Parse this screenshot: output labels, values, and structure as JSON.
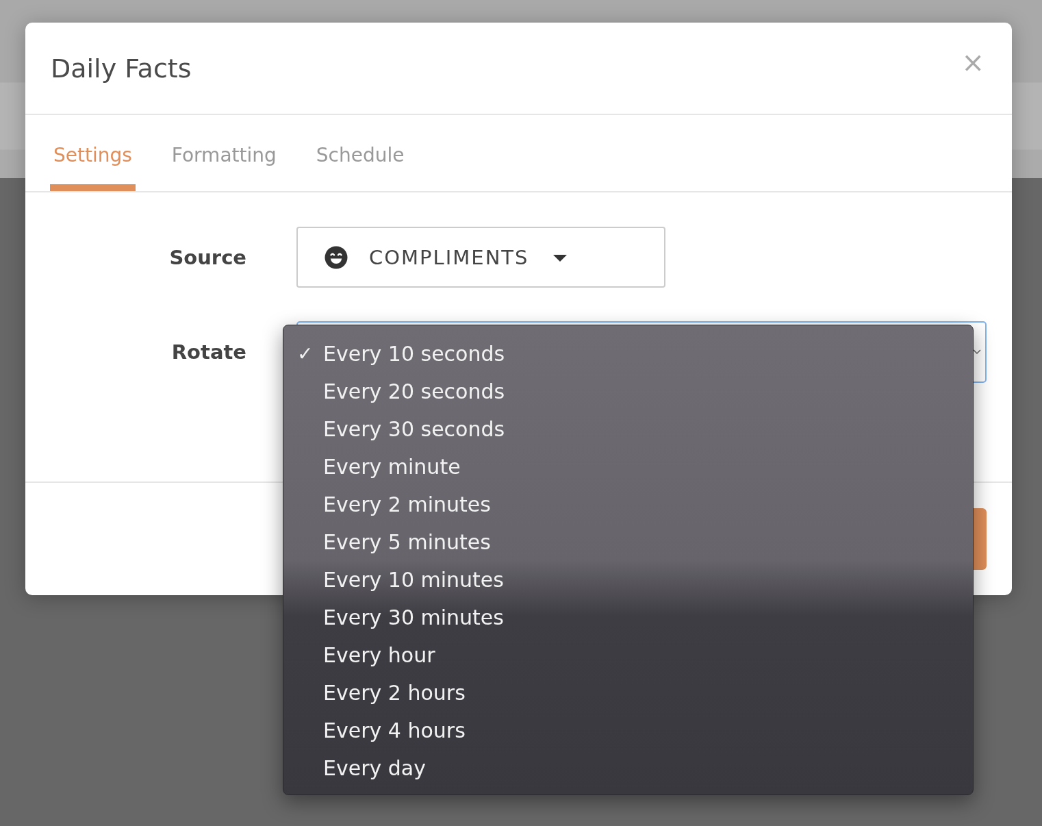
{
  "dialog": {
    "title": "Daily Facts",
    "close": "×"
  },
  "tabs": [
    {
      "label": "Settings",
      "selected": true
    },
    {
      "label": "Formatting",
      "selected": false
    },
    {
      "label": "Schedule",
      "selected": false
    }
  ],
  "fields": [
    {
      "label": "Source",
      "kind": "select",
      "value": "COMPLIMENTS"
    },
    {
      "label": "Rotate",
      "kind": "open_select"
    }
  ],
  "menu": {
    "check": "✓",
    "items": [
      {
        "label": "Every 10 seconds",
        "selected": true
      },
      {
        "label": "Every 20 seconds",
        "selected": false
      },
      {
        "label": "Every 30 seconds",
        "selected": false
      },
      {
        "label": "Every minute",
        "selected": false
      },
      {
        "label": "Every 2 minutes",
        "selected": false
      },
      {
        "label": "Every 5 minutes",
        "selected": false
      },
      {
        "label": "Every 10 minutes",
        "selected": false
      },
      {
        "label": "Every 30 minutes",
        "selected": false
      },
      {
        "label": "Every hour",
        "selected": false
      },
      {
        "label": "Every 2 hours",
        "selected": false
      },
      {
        "label": "Every 4 hours",
        "selected": false
      },
      {
        "label": "Every day",
        "selected": false
      }
    ]
  }
}
